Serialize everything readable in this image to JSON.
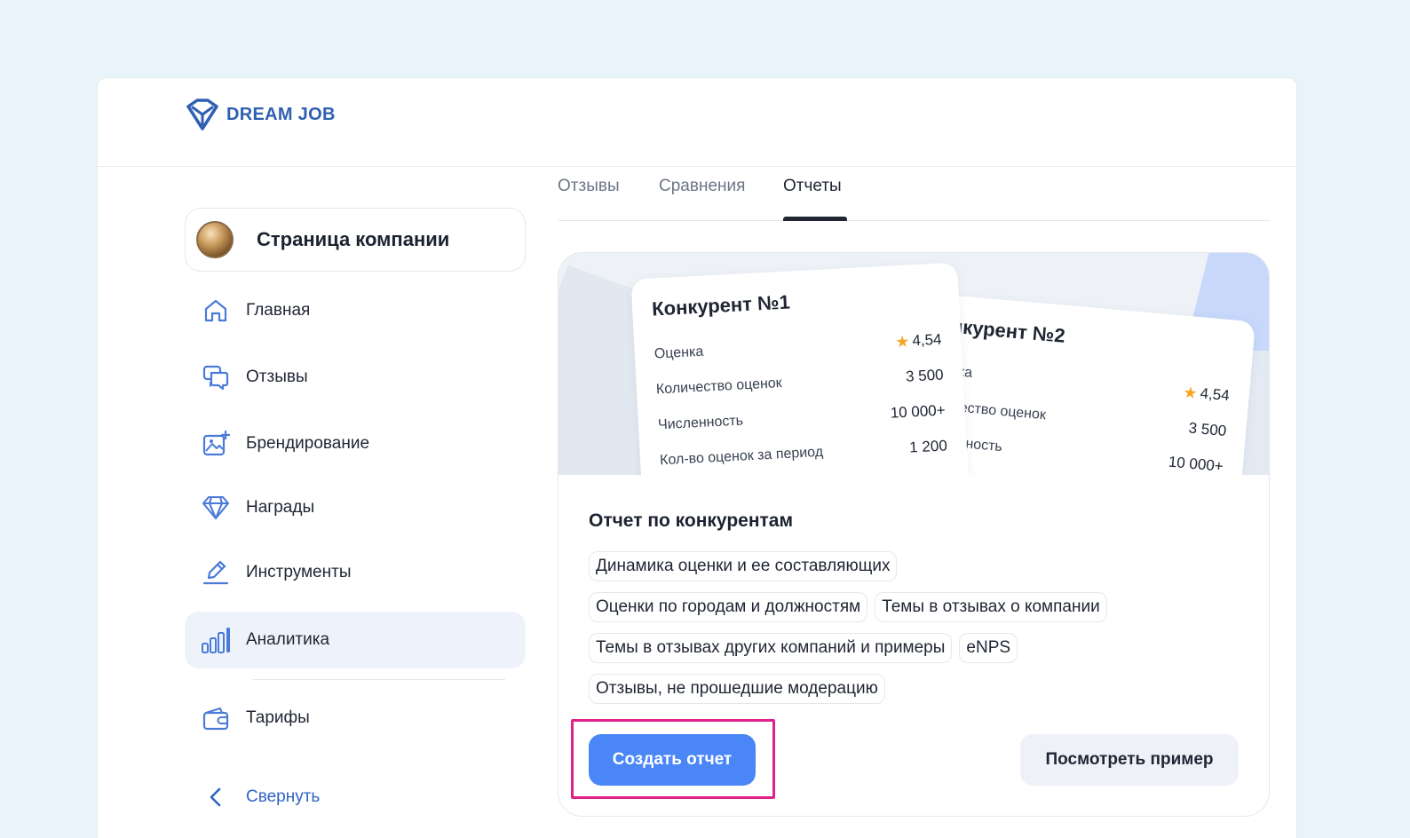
{
  "brand": {
    "name": "DREAM JOB",
    "accent": "#2f5fb0"
  },
  "sidebar": {
    "company_label": "Страница компании",
    "items": [
      {
        "label": "Главная",
        "icon": "home-icon"
      },
      {
        "label": "Отзывы",
        "icon": "chat-bubbles-icon"
      },
      {
        "label": "Брендирование",
        "icon": "image-plus-icon"
      },
      {
        "label": "Награды",
        "icon": "diamond-icon"
      },
      {
        "label": "Инструменты",
        "icon": "pencil-icon"
      },
      {
        "label": "Аналитика",
        "icon": "bar-chart-icon",
        "active": true
      },
      {
        "label": "Тарифы",
        "icon": "wallet-icon"
      }
    ],
    "collapse_label": "Свернуть"
  },
  "tabs": [
    {
      "label": "Отзывы"
    },
    {
      "label": "Сравнения"
    },
    {
      "label": "Отчеты",
      "active": true
    }
  ],
  "banner": {
    "competitor1": {
      "title": "Конкурент №1",
      "rows": [
        {
          "label": "Оценка",
          "value": "4,54"
        },
        {
          "label": "Количество оценок",
          "value": "3 500"
        },
        {
          "label": "Численность",
          "value": "10 000+"
        },
        {
          "label": "Кол-во оценок за период",
          "value": "1 200"
        }
      ]
    },
    "competitor2": {
      "title": "Конкурент №2",
      "rows": [
        {
          "label": "Оценка",
          "value": "4,54"
        },
        {
          "label": "Количество оценок",
          "value": "3 500"
        },
        {
          "label": "Численность",
          "value": "10 000+"
        }
      ]
    }
  },
  "report": {
    "title": "Отчет по конкурентам",
    "chips": [
      "Динамика оценки и ее составляющих",
      "Оценки по городам и должностям",
      "Темы в отзывах о компании",
      "Темы в отзывах других компаний и примеры",
      "eNPS",
      "Отзывы, не прошедшие модерацию"
    ],
    "create_button": "Создать отчет",
    "example_button": "Посмотреть пример",
    "primary_color": "#4a86f6",
    "highlight_color": "#e0218a"
  }
}
